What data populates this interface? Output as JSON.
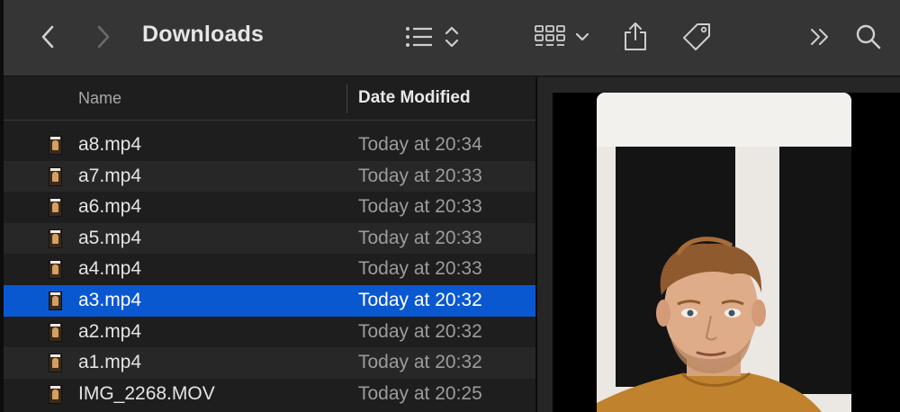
{
  "toolbar": {
    "title": "Downloads",
    "icons": [
      "back-chevron-icon",
      "forward-chevron-icon",
      "list-view-icon",
      "sort-updown-icon",
      "icon-grid-view-icon",
      "dropdown-chevron-icon",
      "share-icon",
      "tag-icon",
      "more-chevrons-icon",
      "search-icon"
    ]
  },
  "columns": {
    "name": "Name",
    "date": "Date Modified"
  },
  "files": [
    {
      "name": "a8.mp4",
      "date": "Today at 20:34"
    },
    {
      "name": "a7.mp4",
      "date": "Today at 20:33"
    },
    {
      "name": "a6.mp4",
      "date": "Today at 20:33"
    },
    {
      "name": "a5.mp4",
      "date": "Today at 20:33"
    },
    {
      "name": "a4.mp4",
      "date": "Today at 20:33"
    },
    {
      "name": "a3.mp4",
      "date": "Today at 20:32"
    },
    {
      "name": "a2.mp4",
      "date": "Today at 20:32"
    },
    {
      "name": "a1.mp4",
      "date": "Today at 20:32"
    },
    {
      "name": "IMG_2268.MOV",
      "date": "Today at 20:25"
    }
  ],
  "selected_file": "a3.mp4",
  "colors": {
    "selection": "#0a58d0",
    "toolbar": "#353535",
    "background": "#1e1e1e"
  }
}
